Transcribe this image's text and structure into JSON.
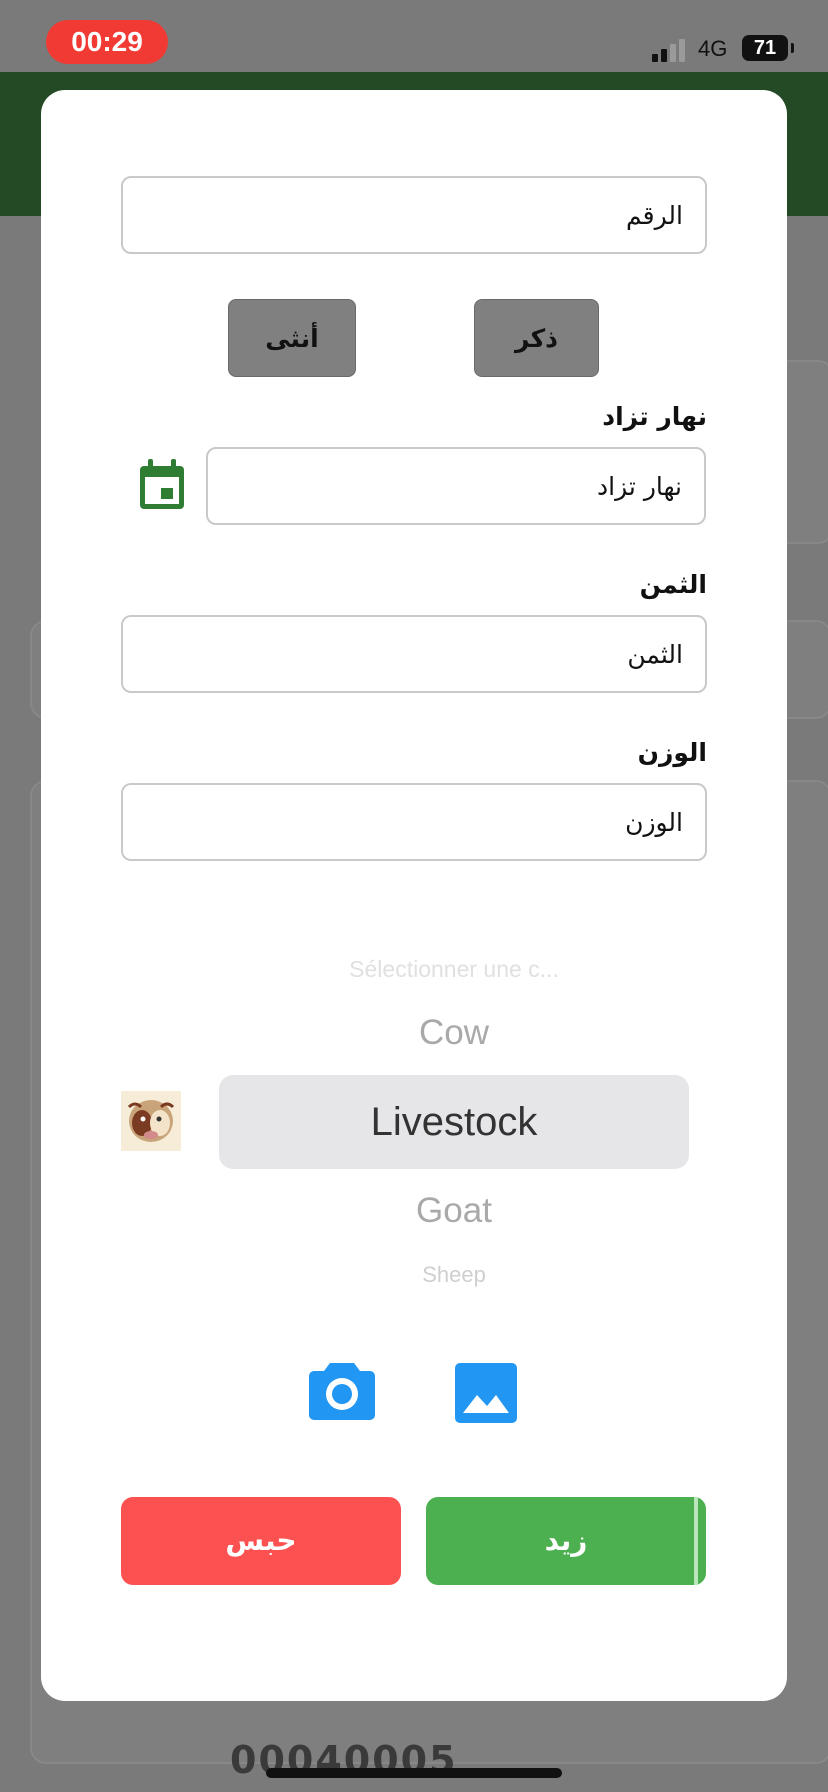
{
  "status_bar": {
    "time": "00:29",
    "network": "4G",
    "battery": "71"
  },
  "background": {
    "partial_text": "00040005"
  },
  "form": {
    "number": {
      "placeholder": "الرقم"
    },
    "gender": {
      "male_label": "ذكر",
      "female_label": "أنثى"
    },
    "birth_date": {
      "label": "نهار تزاد",
      "placeholder": "نهار تزاد"
    },
    "price": {
      "label": "الثمن",
      "placeholder": "الثمن"
    },
    "weight": {
      "label": "الوزن",
      "placeholder": "الوزن"
    },
    "category_picker": {
      "options": [
        "Sélectionner une c...",
        "Cow",
        "Livestock",
        "Goat",
        "Sheep"
      ],
      "selected": "Livestock"
    },
    "actions": {
      "cancel_label": "حبس",
      "add_label": "زيد"
    }
  },
  "colors": {
    "header_green": "#234a24",
    "calendar_green": "#2e7d32",
    "icon_blue": "#2196f3",
    "cancel_red": "#fc5151",
    "add_green": "#4caf50",
    "time_badge_red": "#f23a34"
  },
  "icons": [
    "calendar-icon",
    "camera-icon",
    "gallery-icon",
    "livestock-logo"
  ]
}
